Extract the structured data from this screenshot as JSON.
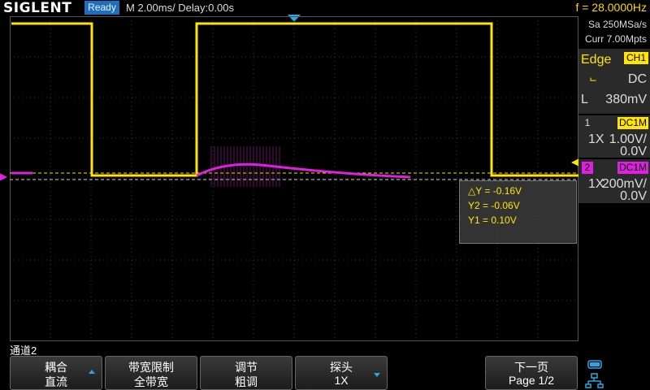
{
  "header": {
    "brand": "SIGLENT",
    "status": "Ready",
    "timebase": "M 2.00ms/ Delay:0.00s",
    "frequency": "f = 28.0000Hz"
  },
  "acquisition": {
    "sample_rate": "Sa 250MSa/s",
    "memory": "Curr 7.00Mpts"
  },
  "trigger": {
    "type": "Edge",
    "source": "CH1",
    "coupling": "DC",
    "level_label": "L",
    "level": "380mV"
  },
  "channels": [
    {
      "num": "1",
      "tag": "DC1M",
      "probe": "1X",
      "scale": "1.00V/",
      "offset": "0.0V",
      "color": "#ffe500"
    },
    {
      "num": "2",
      "tag": "DC1M",
      "probe": "1X",
      "scale": "200mV/",
      "offset": "0.0V",
      "color": "#e020e0"
    }
  ],
  "cursors": {
    "delta_y": "△Y = -0.16V",
    "y2": "Y2 = -0.06V",
    "y1": "Y1 = 0.10V"
  },
  "menu": {
    "title": "通道2",
    "buttons": [
      {
        "l1": "耦合",
        "l2": "直流",
        "arrow": "up"
      },
      {
        "l1": "带宽限制",
        "l2": "全带宽",
        "arrow": ""
      },
      {
        "l1": "调节",
        "l2": "粗调",
        "arrow": ""
      },
      {
        "l1": "探头",
        "l2": "1X",
        "arrow": "down"
      },
      {
        "l1": "下一页",
        "l2": "Page 1/2",
        "arrow": ""
      }
    ]
  },
  "colors": {
    "ch1": "#ffe500",
    "ch2": "#e020e0",
    "accent": "#2aa6e0",
    "ready_bg": "#1f6fc0"
  }
}
